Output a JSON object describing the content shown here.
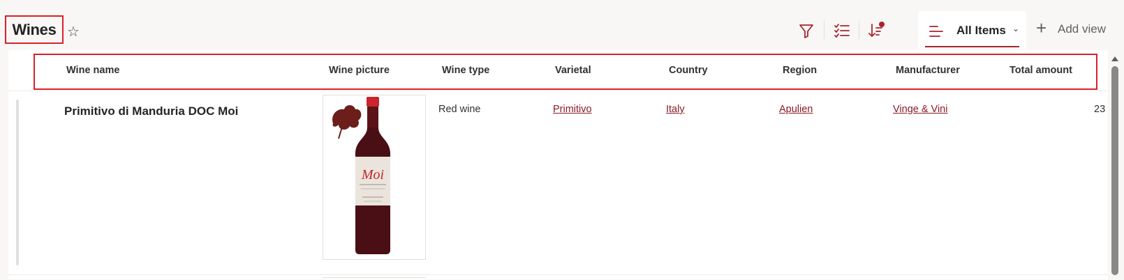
{
  "header": {
    "title": "Wines",
    "view_label": "All Items",
    "add_view_label": "Add view"
  },
  "icons": {
    "favorite": "star-outline-icon",
    "filter": "filter-icon",
    "group": "checklist-icon",
    "sort": "sort-descending-icon",
    "view": "list-lines-icon",
    "add": "plus-icon"
  },
  "colors": {
    "accent": "#a4262c",
    "link": "#8b1a26",
    "highlight_border": "#d92128"
  },
  "columns": [
    "Wine name",
    "Wine picture",
    "Wine type",
    "Varietal",
    "Country",
    "Region",
    "Manufacturer",
    "Total amount"
  ],
  "rows": [
    {
      "wine_name": "Primitivo di Manduria DOC Moi",
      "wine_type": "Red wine",
      "varietal": "Primitivo",
      "country": "Italy",
      "region": "Apulien",
      "manufacturer": "Vinge & Vini",
      "total_amount": "23",
      "label_script": "Moi"
    }
  ]
}
